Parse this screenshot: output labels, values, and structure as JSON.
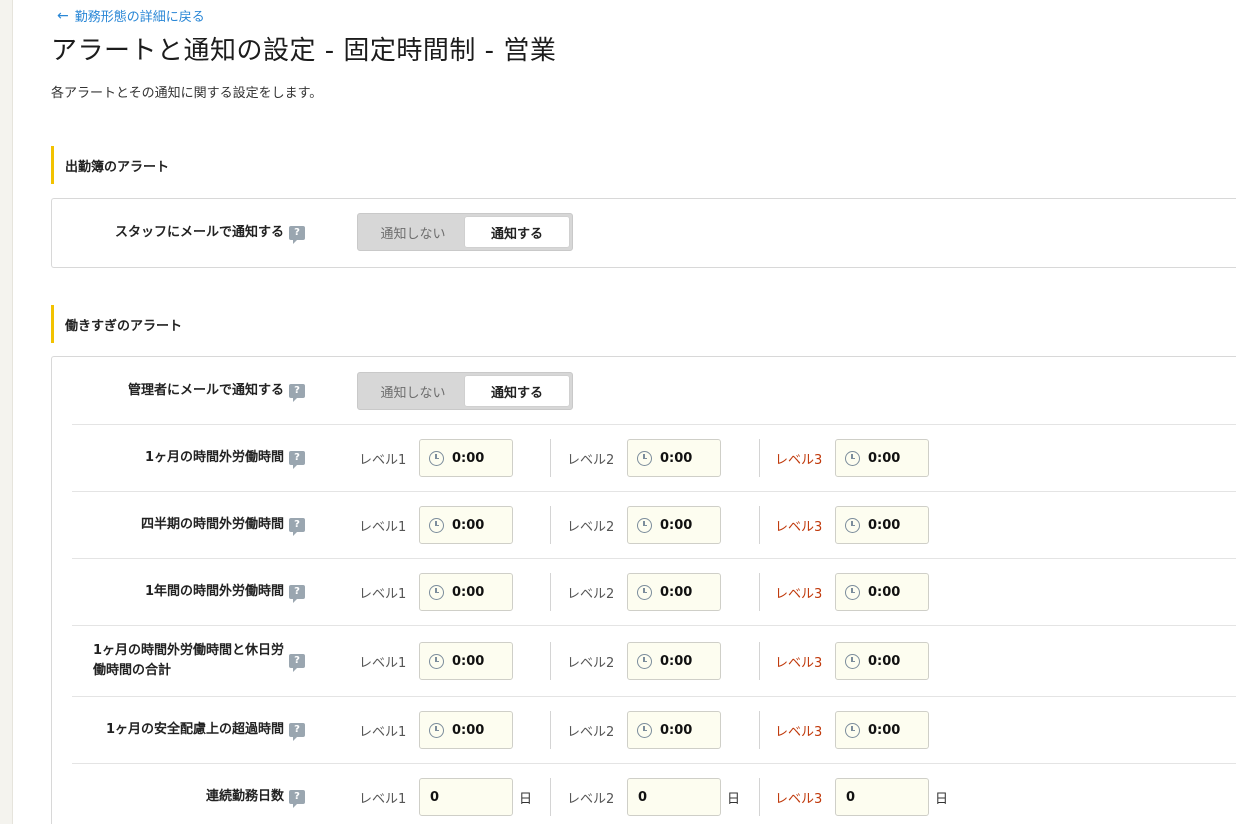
{
  "back_link": "勤務形態の詳細に戻る",
  "page_title": "アラートと通知の設定 - 固定時間制 - 営業",
  "page_desc": "各アラートとその通知に関する設定をします。",
  "help_glyph": "?",
  "sections": [
    {
      "title": "出勤簿のアラート",
      "rows": [
        {
          "label": "スタッフにメールで通知する",
          "type": "toggle",
          "options": [
            "通知しない",
            "通知する"
          ],
          "selected": "通知する"
        }
      ]
    },
    {
      "title": "働きすぎのアラート",
      "rows": [
        {
          "label": "管理者にメールで通知する",
          "type": "toggle",
          "options": [
            "通知しない",
            "通知する"
          ],
          "selected": "通知する"
        },
        {
          "label": "1ヶ月の時間外労働時間",
          "type": "levels",
          "values": [
            "0:00",
            "0:00",
            "0:00"
          ]
        },
        {
          "label": "四半期の時間外労働時間",
          "type": "levels",
          "values": [
            "0:00",
            "0:00",
            "0:00"
          ]
        },
        {
          "label": "1年間の時間外労働時間",
          "type": "levels",
          "values": [
            "0:00",
            "0:00",
            "0:00"
          ]
        },
        {
          "label_line1": "1ヶ月の時間外労働時間と休日労",
          "label_line2": "働時間の合計",
          "type": "levels",
          "values": [
            "0:00",
            "0:00",
            "0:00"
          ]
        },
        {
          "label": "1ヶ月の安全配慮上の超過時間",
          "type": "levels",
          "values": [
            "0:00",
            "0:00",
            "0:00"
          ]
        },
        {
          "label": "連続勤務日数",
          "type": "days",
          "values": [
            "0",
            "0",
            "0"
          ],
          "unit": "日"
        }
      ]
    }
  ],
  "levels": [
    "レベル1",
    "レベル2",
    "レベル3"
  ],
  "colors": {
    "accent_bar": "#f2c200",
    "link": "#2a87d6",
    "level3": "#c0390b",
    "input_bg": "#fdfdf0"
  }
}
